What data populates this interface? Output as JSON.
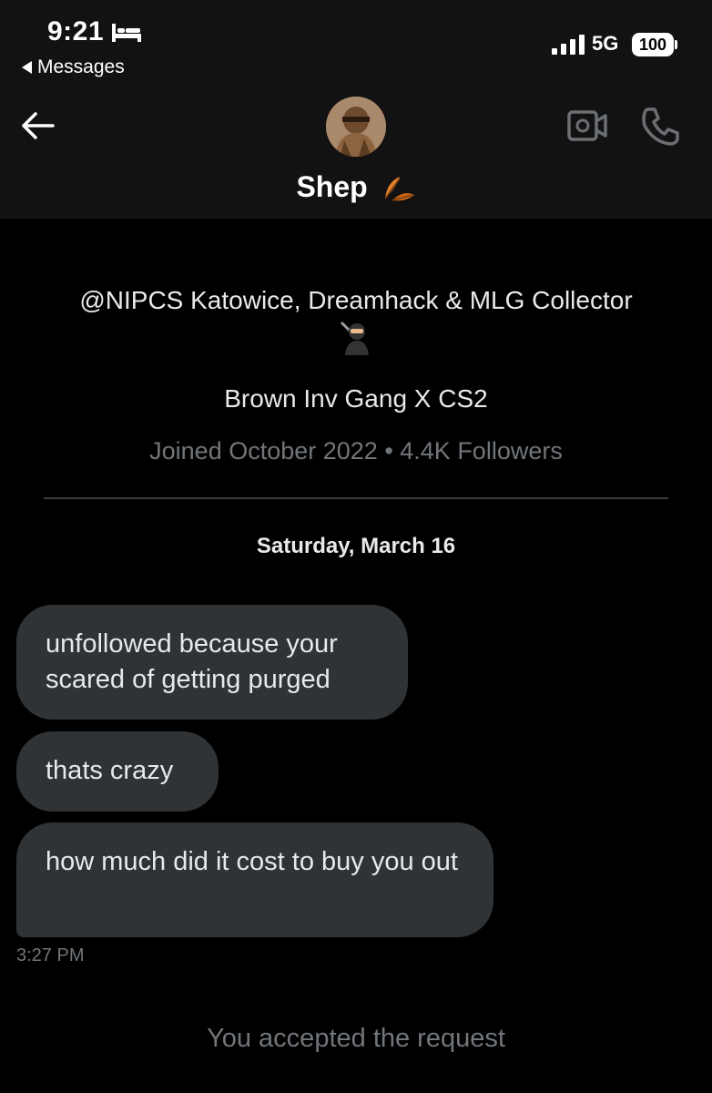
{
  "status_bar": {
    "time": "9:21",
    "back_app": "Messages",
    "network": "5G",
    "battery": "100"
  },
  "header": {
    "name": "Shep",
    "icons": [
      "back-arrow-icon",
      "video-call-icon",
      "phone-call-icon",
      "leaf-emoji-icon"
    ]
  },
  "profile": {
    "bio": "@NIPCS Katowice, Dreamhack & MLG Collector",
    "tagline": "Brown Inv Gang X CS2",
    "meta": "Joined October 2022 • 4.4K Followers"
  },
  "conversation": {
    "date": "Saturday, March 16",
    "messages": [
      {
        "text": "unfollowed because your scared of getting purged"
      },
      {
        "text": "thats crazy"
      },
      {
        "text": "how much did it cost to buy you out"
      }
    ],
    "last_time": "3:27 PM",
    "system_note": "You accepted the request"
  },
  "colors": {
    "background": "#000000",
    "header_bg": "#121212",
    "bubble": "#2f3336",
    "muted_text": "#71767b"
  }
}
